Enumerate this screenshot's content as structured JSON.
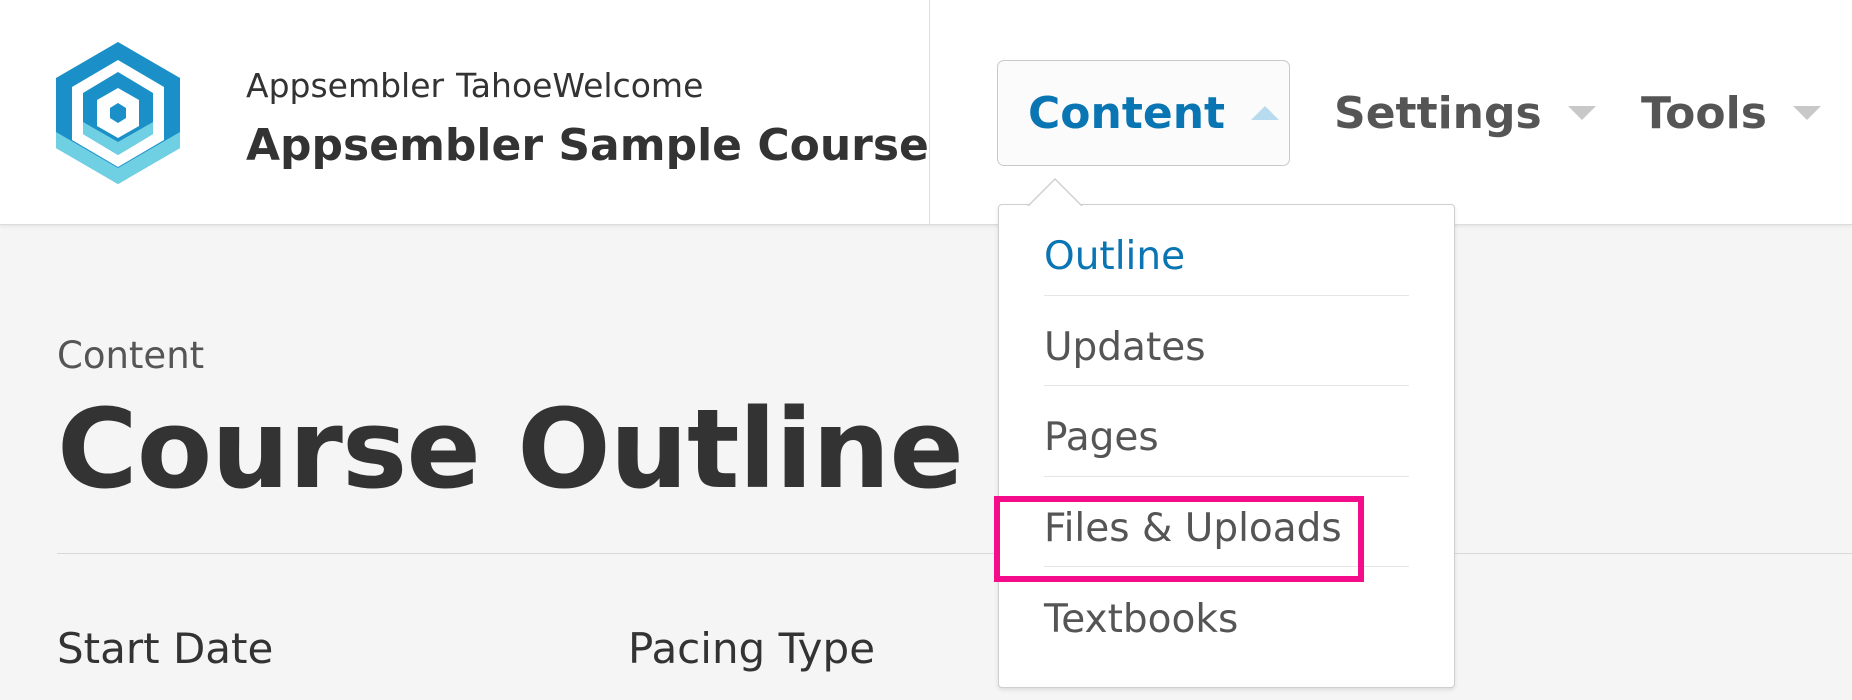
{
  "header": {
    "org_name": "Appsembler",
    "org_welcome": "TahoeWelcome",
    "course_title": "Appsembler Sample Course",
    "logo_colors": [
      "#1a8fc8",
      "#6fd0e3"
    ]
  },
  "nav": {
    "content_label": "Content",
    "settings_label": "Settings",
    "tools_label": "Tools",
    "active_color": "#0a75b3"
  },
  "dropdown": {
    "items": [
      {
        "label": "Outline",
        "active": true
      },
      {
        "label": "Updates",
        "active": false
      },
      {
        "label": "Pages",
        "active": false
      },
      {
        "label": "Files & Uploads",
        "active": false,
        "highlighted": true
      },
      {
        "label": "Textbooks",
        "active": false
      }
    ],
    "highlight_color": "#f50c8a"
  },
  "main": {
    "section_label": "Content",
    "page_title": "Course Outline",
    "fields": {
      "start_date_label": "Start Date",
      "pacing_type_label": "Pacing Type"
    }
  }
}
